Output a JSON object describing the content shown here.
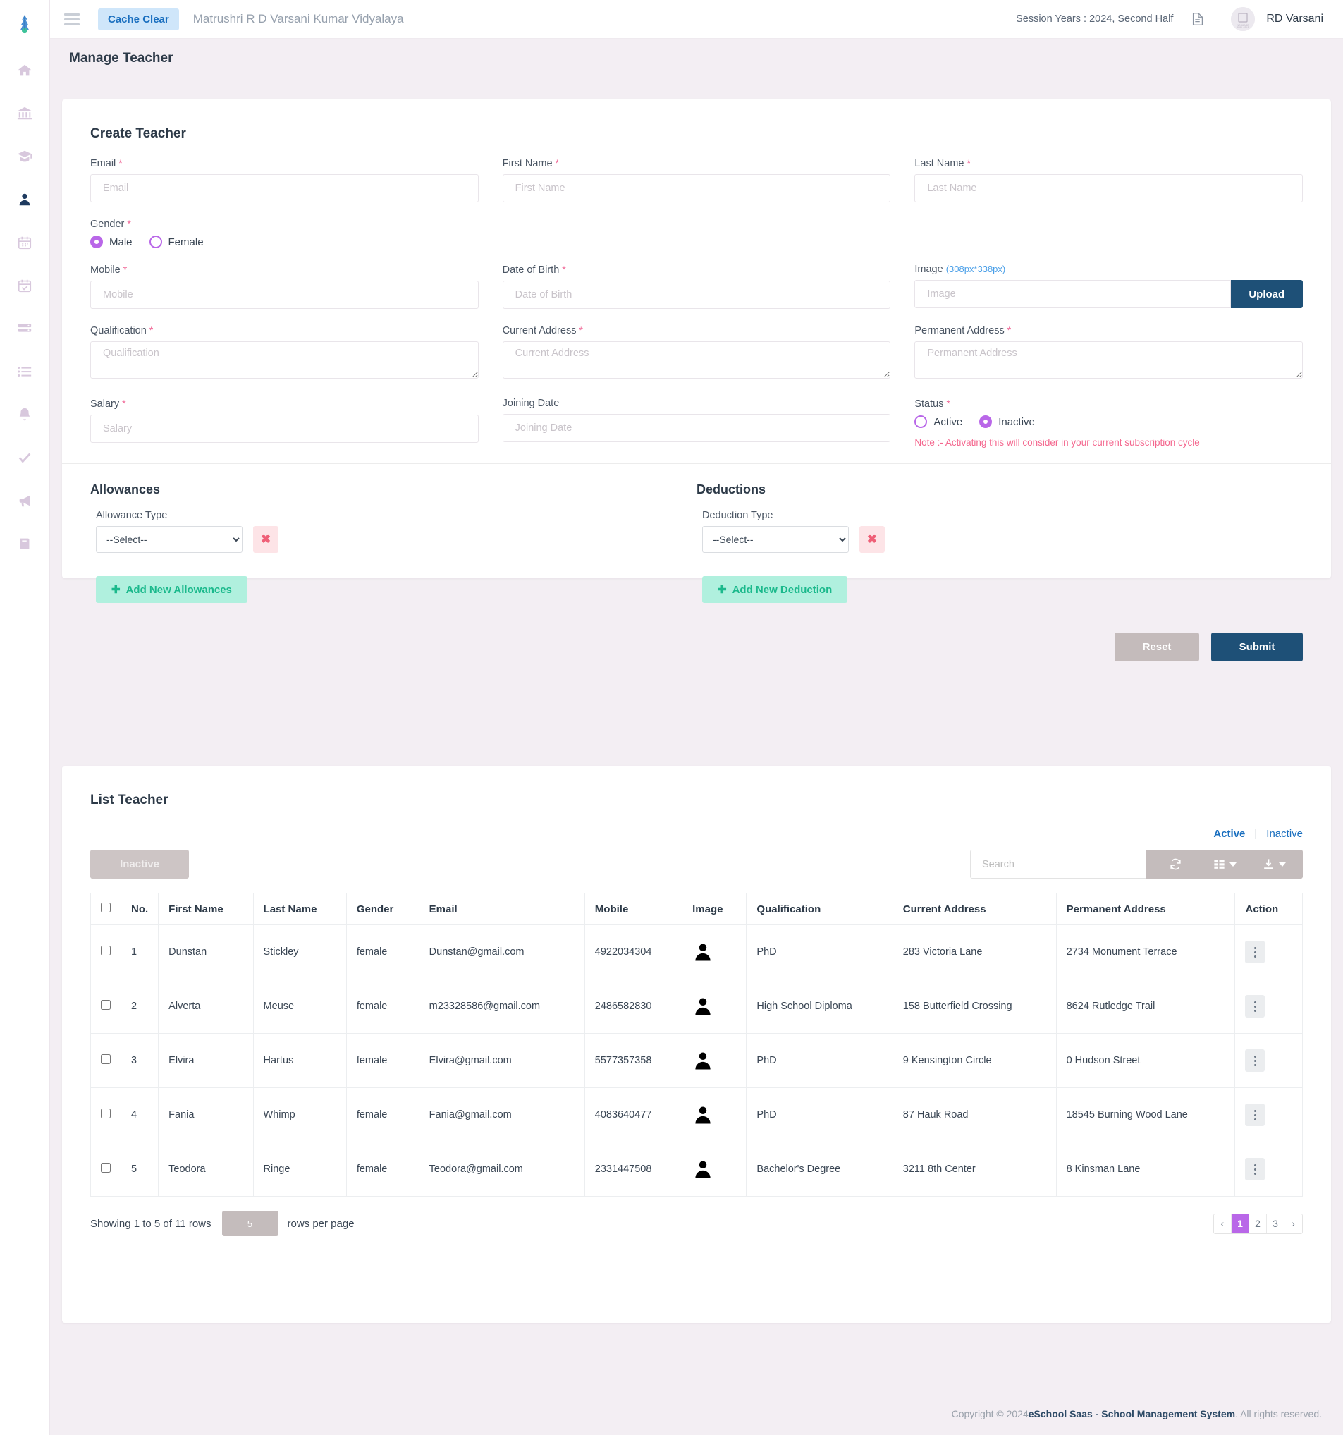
{
  "topbar": {
    "cache_clear": "Cache Clear",
    "school_name": "Matrushri R D Varsani Kumar Vidyalaya",
    "session_years": "Session Years : 2024, Second Half",
    "user_name": "RD Varsani",
    "avatar_text": "NO IMAGE AVAILABLE"
  },
  "sidebar": {
    "items": [
      {
        "name": "home-icon"
      },
      {
        "name": "bank-icon"
      },
      {
        "name": "graduation-cap-icon"
      },
      {
        "name": "user-icon"
      },
      {
        "name": "calendar-icon"
      },
      {
        "name": "calendar-check-icon"
      },
      {
        "name": "server-icon"
      },
      {
        "name": "list-icon"
      },
      {
        "name": "bell-icon"
      },
      {
        "name": "check-icon"
      },
      {
        "name": "megaphone-icon"
      },
      {
        "name": "book-icon"
      }
    ]
  },
  "page": {
    "title": "Manage Teacher"
  },
  "create_form": {
    "title": "Create Teacher",
    "fields": {
      "email": {
        "label": "Email",
        "placeholder": "Email",
        "value": "",
        "required": "*"
      },
      "first_name": {
        "label": "First Name",
        "placeholder": "First Name",
        "value": "",
        "required": "*"
      },
      "last_name": {
        "label": "Last Name",
        "placeholder": "Last Name",
        "value": "",
        "required": "*"
      },
      "gender": {
        "label": "Gender",
        "required": "*",
        "options": [
          "Male",
          "Female"
        ],
        "selected": "Male"
      },
      "mobile": {
        "label": "Mobile",
        "placeholder": "Mobile",
        "value": "",
        "required": "*"
      },
      "dob": {
        "label": "Date of Birth",
        "placeholder": "Date of Birth",
        "value": "",
        "required": "*"
      },
      "image": {
        "label": "Image",
        "hint": "(308px*338px)",
        "placeholder": "Image",
        "value": "",
        "upload_label": "Upload"
      },
      "qualification": {
        "label": "Qualification",
        "placeholder": "Qualification",
        "value": "",
        "required": "*"
      },
      "current_address": {
        "label": "Current Address",
        "placeholder": "Current Address",
        "value": "",
        "required": "*"
      },
      "permanent_address": {
        "label": "Permanent Address",
        "placeholder": "Permanent Address",
        "value": "",
        "required": "*"
      },
      "salary": {
        "label": "Salary",
        "placeholder": "Salary",
        "value": "",
        "required": "*"
      },
      "joining_date": {
        "label": "Joining Date",
        "placeholder": "Joining Date",
        "value": ""
      },
      "status": {
        "label": "Status",
        "required": "*",
        "options": [
          "Active",
          "Inactive"
        ],
        "selected": "Inactive",
        "note": "Note :- Activating this will consider in your current subscription cycle"
      }
    },
    "allowances": {
      "title": "Allowances",
      "type_label": "Allowance Type",
      "select_value": "--Select--",
      "remove_label": "✖",
      "add_label": "Add New Allowances"
    },
    "deductions": {
      "title": "Deductions",
      "type_label": "Deduction Type",
      "select_value": "--Select--",
      "remove_label": "✖",
      "add_label": "Add New Deduction"
    },
    "reset_label": "Reset",
    "submit_label": "Submit"
  },
  "list_section": {
    "title": "List Teacher",
    "tab_active": "Active",
    "tab_inactive": "Inactive",
    "tab_separator": "|",
    "inactive_button": "Inactive",
    "search_placeholder": "Search",
    "columns": [
      "No.",
      "First Name",
      "Last Name",
      "Gender",
      "Email",
      "Mobile",
      "Image",
      "Qualification",
      "Current Address",
      "Permanent Address",
      "Action"
    ],
    "rows": [
      {
        "no": "1",
        "first_name": "Dunstan",
        "last_name": "Stickley",
        "gender": "female",
        "email": "Dunstan@gmail.com",
        "mobile": "4922034304",
        "qualification": "PhD",
        "current_address": "283 Victoria Lane",
        "permanent_address": "2734 Monument Terrace"
      },
      {
        "no": "2",
        "first_name": "Alverta",
        "last_name": "Meuse",
        "gender": "female",
        "email": "m23328586@gmail.com",
        "mobile": "2486582830",
        "qualification": "High School Diploma",
        "current_address": "158 Butterfield Crossing",
        "permanent_address": "8624 Rutledge Trail"
      },
      {
        "no": "3",
        "first_name": "Elvira",
        "last_name": "Hartus",
        "gender": "female",
        "email": "Elvira@gmail.com",
        "mobile": "5577357358",
        "qualification": "PhD",
        "current_address": "9 Kensington Circle",
        "permanent_address": "0 Hudson Street"
      },
      {
        "no": "4",
        "first_name": "Fania",
        "last_name": "Whimp",
        "gender": "female",
        "email": "Fania@gmail.com",
        "mobile": "4083640477",
        "qualification": "PhD",
        "current_address": "87 Hauk Road",
        "permanent_address": "18545 Burning Wood Lane"
      },
      {
        "no": "5",
        "first_name": "Teodora",
        "last_name": "Ringe",
        "gender": "female",
        "email": "Teodora@gmail.com",
        "mobile": "2331447508",
        "qualification": "Bachelor's Degree",
        "current_address": "3211 8th Center",
        "permanent_address": "8 Kinsman Lane"
      }
    ],
    "showing_text": "Showing 1 to 5 of 11 rows",
    "rows_per_page_value": "5",
    "rows_per_page_label": "rows per page",
    "pagination": {
      "prev": "‹",
      "pages": [
        "1",
        "2",
        "3"
      ],
      "current": "1",
      "next": "›"
    }
  },
  "footer": {
    "prefix": "Copyright © 2024 ",
    "brand": "eSchool Saas - School Management System",
    "suffix": ". All rights reserved."
  },
  "colors": {
    "accent_purple": "#b967e8",
    "dark_blue": "#1e5077",
    "pink_required": "#f06595",
    "teal": "#1bb98c",
    "link_blue": "#1a6fbf"
  }
}
